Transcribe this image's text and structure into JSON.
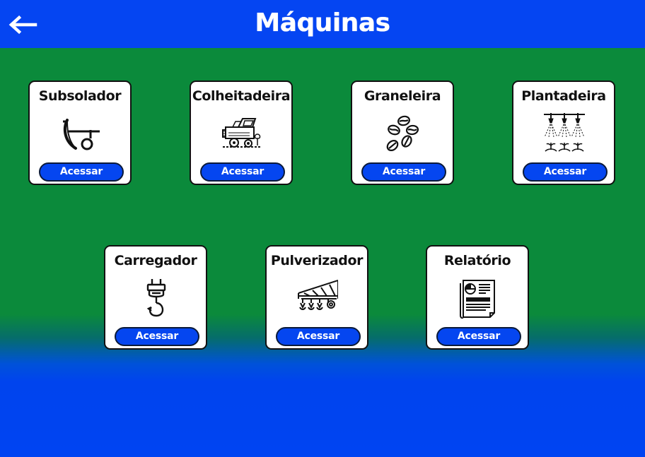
{
  "header": {
    "title": "Máquinas",
    "back_icon": "arrow-left-icon",
    "color": "#0545f2"
  },
  "colors": {
    "background_top": "#0b8a3b",
    "background_bottom": "#0044f2",
    "button": "#0546f0"
  },
  "cards": [
    {
      "title": "Subsolador",
      "button_label": "Acessar",
      "icon": "subsoiler-plow-icon"
    },
    {
      "title": "Colheitadeira",
      "button_label": "Acessar",
      "icon": "combine-harvester-icon"
    },
    {
      "title": "Graneleira",
      "button_label": "Acessar",
      "icon": "grain-beans-icon"
    },
    {
      "title": "Plantadeira",
      "button_label": "Acessar",
      "icon": "sprinkler-seedlings-icon"
    },
    {
      "title": "Carregador",
      "button_label": "Acessar",
      "icon": "plug-hook-icon"
    },
    {
      "title": "Pulverizador",
      "button_label": "Acessar",
      "icon": "sprayer-icon"
    },
    {
      "title": "Relatório",
      "button_label": "Acessar",
      "icon": "report-document-icon"
    }
  ]
}
